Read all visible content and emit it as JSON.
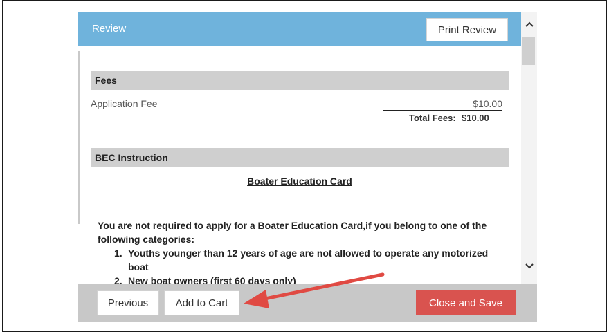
{
  "dialog": {
    "title": "Review",
    "print_button": "Print Review"
  },
  "fees": {
    "header": "Fees",
    "items": [
      {
        "label": "Application Fee",
        "amount": "$10.00"
      }
    ],
    "total_label": "Total Fees:",
    "total_value": "$10.00"
  },
  "instruction": {
    "header": "BEC Instruction",
    "card_title": "Boater Education Card",
    "intro": "You are not required to apply for a Boater Education Card,if you belong to one of the following categories:",
    "list": [
      {
        "num": "1.",
        "text": "Youths younger than 12 years of age are not allowed to operate any motorized",
        "cont": "boat"
      },
      {
        "num": "2.",
        "text": "New boat owners (first 60 days only)"
      }
    ]
  },
  "footer": {
    "previous": "Previous",
    "add_to_cart": "Add to Cart",
    "close_save": "Close and Save"
  },
  "colors": {
    "header_bg": "#6fb3dc",
    "close_button": "#d9534f",
    "arrow": "#e04a43"
  },
  "icons": {
    "scroll_up": "chevron-up-icon",
    "scroll_down": "chevron-down-icon",
    "annotation": "red-arrow-icon"
  }
}
